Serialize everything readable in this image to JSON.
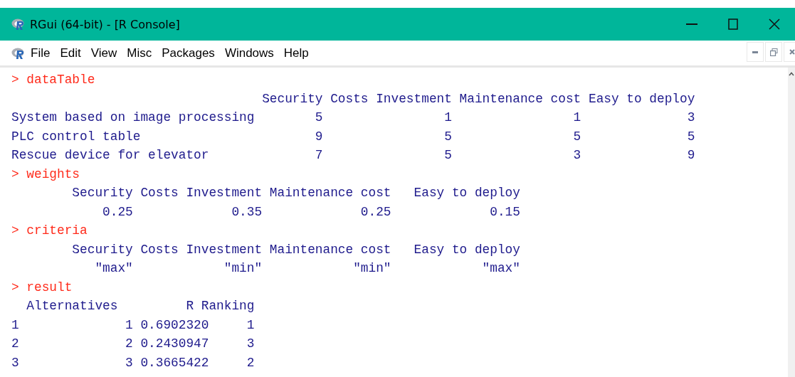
{
  "window": {
    "title": "RGui (64-bit) - [R Console]"
  },
  "menu": {
    "items": [
      {
        "label": "File"
      },
      {
        "label": "Edit"
      },
      {
        "label": "View"
      },
      {
        "label": "Misc"
      },
      {
        "label": "Packages"
      },
      {
        "label": "Windows"
      },
      {
        "label": "Help"
      }
    ]
  },
  "console": {
    "lines": [
      {
        "kind": "command",
        "text": "> dataTable"
      },
      {
        "kind": "output",
        "text": "                                 Security Costs Investment Maintenance cost Easy to deploy"
      },
      {
        "kind": "output",
        "text": "System based on image processing        5                1                1              3"
      },
      {
        "kind": "output",
        "text": "PLC control table                       9                5                5              5"
      },
      {
        "kind": "output",
        "text": "Rescue device for elevator              7                5                3              9"
      },
      {
        "kind": "command",
        "text": "> weights"
      },
      {
        "kind": "output",
        "text": "        Security Costs Investment Maintenance cost   Easy to deploy"
      },
      {
        "kind": "output",
        "text": "            0.25             0.35             0.25             0.15"
      },
      {
        "kind": "command",
        "text": "> criteria"
      },
      {
        "kind": "output",
        "text": "        Security Costs Investment Maintenance cost   Easy to deploy"
      },
      {
        "kind": "output",
        "text": "           \"max\"            \"min\"            \"min\"            \"max\""
      },
      {
        "kind": "command",
        "text": "> result"
      },
      {
        "kind": "output",
        "text": "  Alternatives         R Ranking"
      },
      {
        "kind": "output",
        "text": "1              1 0.6902320     1"
      },
      {
        "kind": "output",
        "text": "2              2 0.2430947     3"
      },
      {
        "kind": "output",
        "text": "3              3 0.3665422     2"
      }
    ]
  }
}
